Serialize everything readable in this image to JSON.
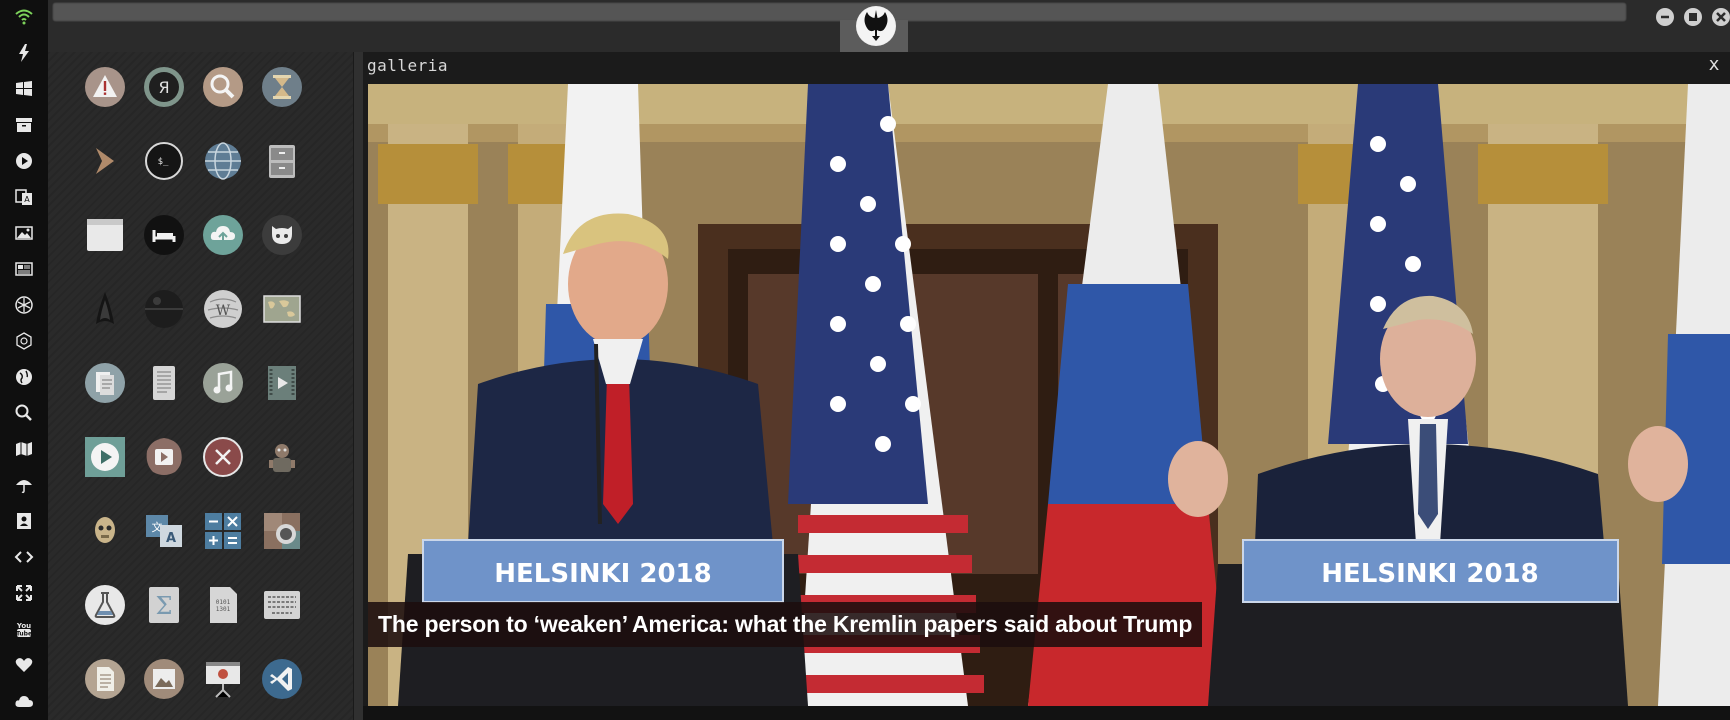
{
  "dock": {
    "items": [
      {
        "icon": "wifi-icon"
      },
      {
        "icon": "lightning-icon"
      },
      {
        "icon": "windows-icon"
      },
      {
        "icon": "archive-icon"
      },
      {
        "icon": "play-circle-icon"
      },
      {
        "icon": "translate-icon"
      },
      {
        "icon": "image-icon"
      },
      {
        "icon": "newspaper-icon"
      },
      {
        "icon": "rebel-alliance-icon"
      },
      {
        "icon": "empire-icon"
      },
      {
        "icon": "globe-icon"
      },
      {
        "icon": "search-icon"
      },
      {
        "icon": "map-icon"
      },
      {
        "icon": "umbrella-icon"
      },
      {
        "icon": "contacts-icon"
      },
      {
        "icon": "code-icon"
      },
      {
        "icon": "expand-icon"
      },
      {
        "icon": "youtube-icon"
      },
      {
        "icon": "heart-icon"
      },
      {
        "icon": "cloud-icon"
      }
    ]
  },
  "topbar": {
    "logo_icon": "rebel-alliance-icon",
    "window_buttons": [
      "minimize-icon",
      "maximize-icon",
      "close-icon"
    ]
  },
  "apps": {
    "grid": [
      [
        "warning-app-icon",
        "yandex-browser-icon",
        "search-app-icon",
        "hourglass-icon"
      ],
      [
        "forward-arrow-icon",
        "terminal-icon",
        "globe-app-icon",
        "file-cabinet-icon"
      ],
      [
        "window-app-icon",
        "bed-icon",
        "cloud-upload-icon",
        "github-icon"
      ],
      [
        "starfleet-icon",
        "death-star-icon",
        "wikipedia-icon",
        "world-map-icon"
      ],
      [
        "document-viewer-icon",
        "text-editor-icon",
        "music-icon",
        "video-icon"
      ],
      [
        "media-player-icon",
        "video-player-icon",
        "x-circle-icon",
        "robot-icon"
      ],
      [
        "c3po-icon",
        "translator-icon",
        "calculator-icon",
        "camera-icon"
      ],
      [
        "chemistry-icon",
        "sigma-icon",
        "binary-file-icon",
        "keyboard-icon"
      ],
      [
        "document-icon",
        "image-viewer-icon",
        "presentation-icon",
        "vscode-icon"
      ]
    ]
  },
  "gallery": {
    "title": "galleria",
    "close_label": "x",
    "photo": {
      "podium_left": "HELSINKI 2018",
      "podium_right": "HELSINKI 2018"
    },
    "caption": "The person to ‘weaken’ America: what the Kremlin papers said about Trump"
  }
}
